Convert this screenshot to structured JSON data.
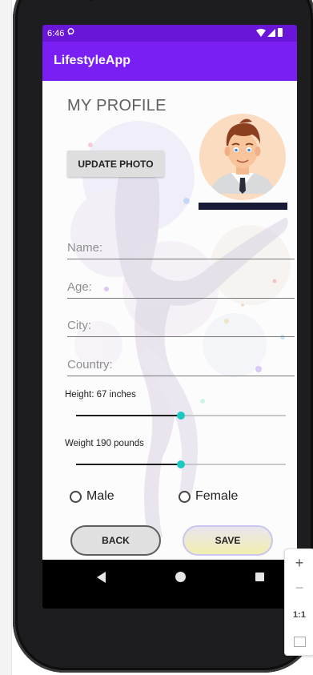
{
  "status_bar": {
    "time": "6:46"
  },
  "app_bar": {
    "title": "LifestyleApp"
  },
  "profile": {
    "heading": "MY PROFILE",
    "update_photo_label": "UPDATE PHOTO"
  },
  "fields": {
    "name_placeholder": "Name:",
    "age_placeholder": "Age:",
    "city_placeholder": "City:",
    "country_placeholder": "Country:"
  },
  "height": {
    "label": "Height: 67 inches",
    "value": 67,
    "level": 0.5
  },
  "weight": {
    "label": "Weight 190 pounds",
    "value": 190,
    "level": 0.5
  },
  "gender": {
    "male_label": "Male",
    "female_label": "Female",
    "selected": null
  },
  "actions": {
    "back_label": "BACK",
    "save_label": "SAVE"
  },
  "zoom_controls": {
    "zoom_in": "+",
    "zoom_out": "−",
    "actual_size": "1:1"
  },
  "colors": {
    "status_bar": "#6a16d8",
    "app_bar": "#7a1ff3",
    "slider_thumb": "#1ec7c1",
    "avatar_bg": "#fcdcc0"
  }
}
